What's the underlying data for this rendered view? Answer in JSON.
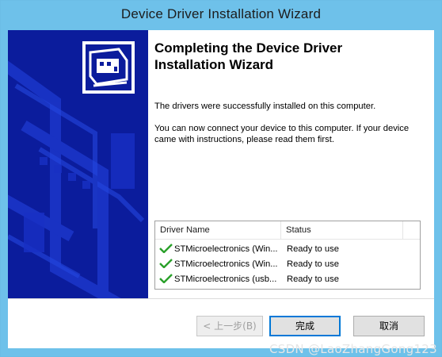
{
  "window": {
    "title": "Device Driver Installation Wizard"
  },
  "main": {
    "heading": "Completing the Device Driver Installation Wizard",
    "message_success": "The drivers were successfully installed on this computer.",
    "message_connect": "You can now connect your device to this computer. If your device came with instructions, please read them first."
  },
  "driver_table": {
    "columns": [
      "Driver Name",
      "Status"
    ],
    "rows": [
      {
        "name": "STMicroelectronics (Win...",
        "status": "Ready to use",
        "icon": "green-check-icon"
      },
      {
        "name": "STMicroelectronics (Win...",
        "status": "Ready to use",
        "icon": "green-check-icon"
      },
      {
        "name": "STMicroelectronics (usb...",
        "status": "Ready to use",
        "icon": "green-check-icon"
      }
    ]
  },
  "buttons": {
    "back_label": "< 上一步(B)",
    "finish_label": "完成",
    "cancel_label": "取消"
  },
  "watermark": "CSDN @LaoZhangGong123",
  "colors": {
    "titlebar": "#6ec1ea",
    "banner": "#0b1c9c",
    "check": "#2aa02a",
    "focus_border": "#0078d7"
  },
  "icons": {
    "banner_logo": "hardware-card-icon"
  }
}
